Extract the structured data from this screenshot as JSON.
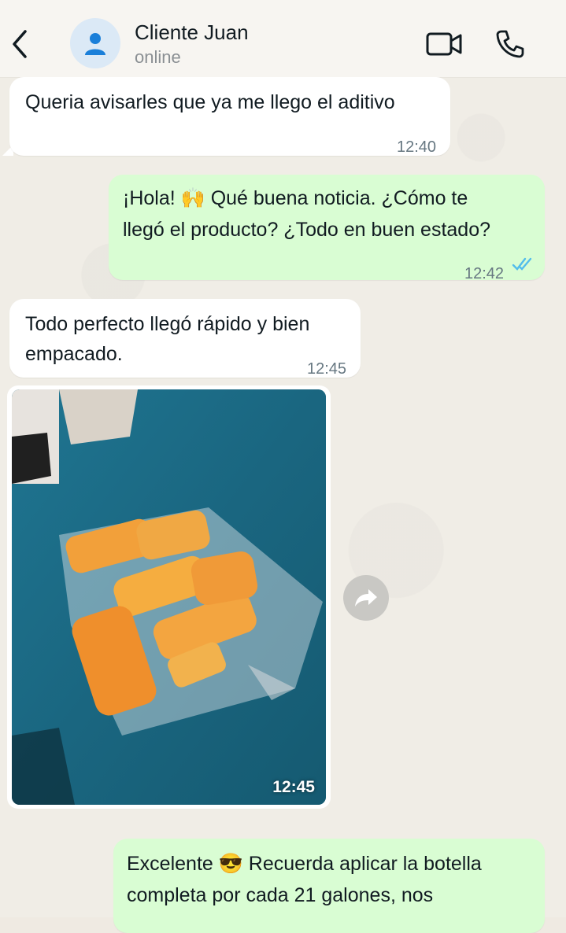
{
  "header": {
    "contact_name": "Cliente Juan",
    "status": "online",
    "icons": [
      "back-arrow-icon",
      "user-icon",
      "video-call-icon",
      "phone-icon"
    ]
  },
  "messages": [
    {
      "direction": "in",
      "lines": [
        "Queria avisarles que ya me llego el aditivo"
      ],
      "time": "12:40"
    },
    {
      "direction": "out",
      "lines": [
        "¡Hola! 🙌 Qué buena noticia. ¿Cómo te",
        "llegó el producto? ¿Todo en buen estado?"
      ],
      "time": "12:42",
      "read_receipt": "double-check-blue"
    },
    {
      "direction": "in",
      "lines": [
        "Todo perfecto llegó rápido y bien",
        "empacado."
      ],
      "time": "12:45"
    },
    {
      "direction": "in",
      "type": "image",
      "time": "12:45",
      "image_desc_icon": "photo"
    },
    {
      "direction": "out",
      "lines": [
        "Excelente 😎 Recuerda aplicar la botella",
        "completa por cada 21 galones, nos"
      ]
    }
  ],
  "colors": {
    "incoming_bubble": "#ffffff",
    "outgoing_bubble": "#d9fdd3",
    "read_tick": "#53bdeb",
    "background": "#efeae2"
  }
}
